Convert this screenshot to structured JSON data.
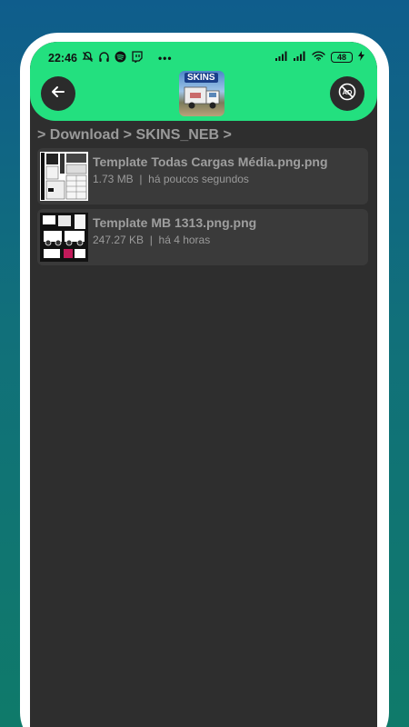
{
  "status_bar": {
    "time": "22:46",
    "battery": "48",
    "left_icons": [
      "notifications-off-icon",
      "headphones-icon",
      "spotify-icon",
      "twitch-icon"
    ],
    "right_icons": [
      "signal-icon",
      "signal-icon",
      "wifi-icon",
      "charging-icon"
    ]
  },
  "header": {
    "logo_text": "SKINS"
  },
  "breadcrumb": "> Download > SKINS_NEB >",
  "files": [
    {
      "name": "Template Todas Cargas Média.png.png",
      "size": "1.73 MB",
      "separator": "|",
      "time": "há poucos segundos"
    },
    {
      "name": "Template MB 1313.png.png",
      "size": "247.27 KB",
      "separator": "|",
      "time": "há 4 horas"
    }
  ],
  "colors": {
    "accent": "#23e07f",
    "screen_bg": "#2e2e2e",
    "item_bg": "#3a3a3a"
  }
}
